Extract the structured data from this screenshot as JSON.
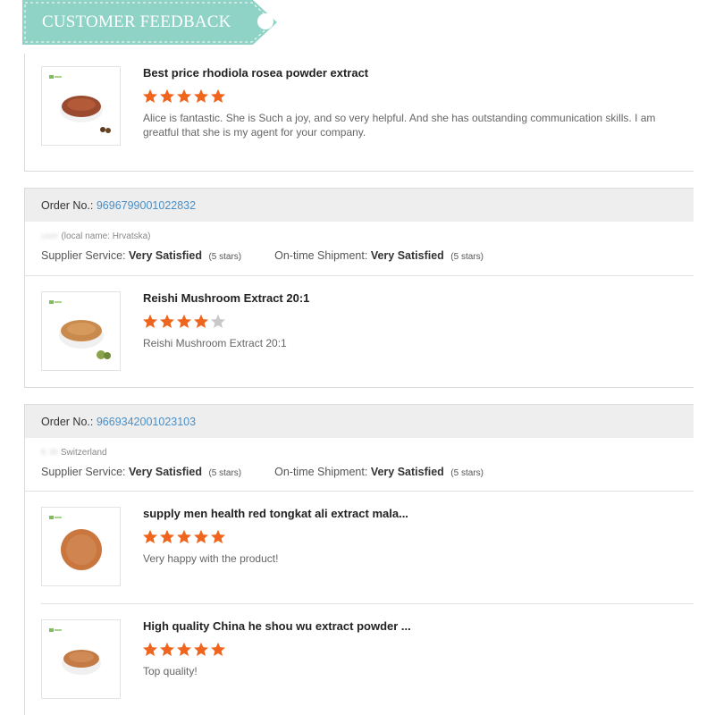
{
  "banner": {
    "title": "CUSTOMER FEEDBACK"
  },
  "colors": {
    "banner": "#8fd3c6",
    "star_on": "#f0651e",
    "star_off": "#c9c9c9",
    "order_link": "#4a8fc7"
  },
  "labels": {
    "order_no": "Order No.:",
    "supplier_service": "Supplier Service:",
    "on_time_shipment": "On-time Shipment:"
  },
  "first_review": {
    "title": "Best price rhodiola rosea powder extract",
    "rating": 5,
    "comment": "Alice is fantastic.  She is Such a joy, and so very helpful.  And she has outstanding communication skills.  I am greatful that she is my agent for your company."
  },
  "orders": [
    {
      "order_no": "9696799001022832",
      "buyer_hidden": "user",
      "buyer_location": "(local name: Hrvatska)",
      "supplier_service": "Very Satisfied",
      "supplier_stars": "(5 stars)",
      "shipment": "Very Satisfied",
      "shipment_stars": "(5 stars)",
      "items": [
        {
          "title": "Reishi Mushroom Extract 20:1",
          "rating": 4,
          "comment": "Reishi Mushroom Extract 20:1"
        }
      ]
    },
    {
      "order_no": "9669342001023103",
      "buyer_hidden": "K W",
      "buyer_location": "Switzerland",
      "supplier_service": "Very Satisfied",
      "supplier_stars": "(5 stars)",
      "shipment": "Very Satisfied",
      "shipment_stars": "(5 stars)",
      "items": [
        {
          "title": "supply men health red tongkat ali extract mala...",
          "rating": 5,
          "comment": "Very happy with the product!"
        },
        {
          "title": "High quality China he shou wu extract powder ...",
          "rating": 5,
          "comment": "Top quality!"
        }
      ]
    }
  ]
}
